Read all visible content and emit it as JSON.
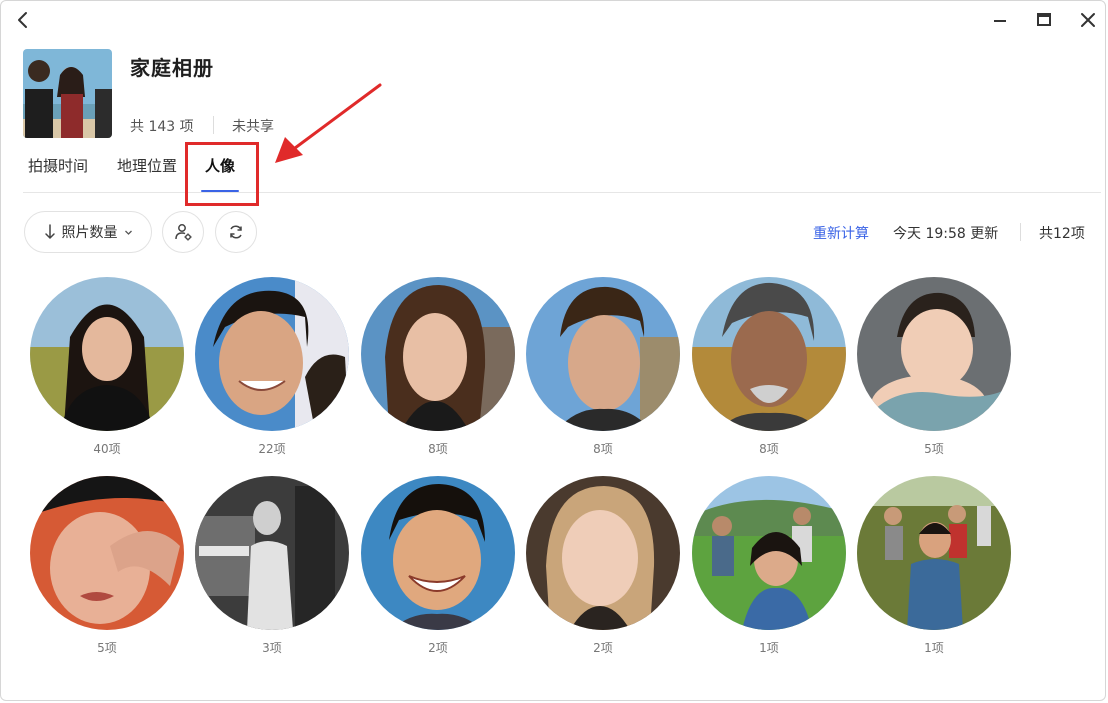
{
  "album": {
    "title": "家庭相册",
    "count": "共 143 项",
    "share_status": "未共享"
  },
  "tabs": [
    {
      "label": "拍摄时间",
      "active": false
    },
    {
      "label": "地理位置",
      "active": false
    },
    {
      "label": "人像",
      "active": true
    }
  ],
  "toolbar": {
    "sort_label": "照片数量",
    "recalculate": "重新计算",
    "updated": "今天 19:58 更新",
    "total": "共12项"
  },
  "people": [
    {
      "count": "40项"
    },
    {
      "count": "22项"
    },
    {
      "count": "8项"
    },
    {
      "count": "8项"
    },
    {
      "count": "8项"
    },
    {
      "count": "5项"
    },
    {
      "count": "5项"
    },
    {
      "count": "3项"
    },
    {
      "count": "2项"
    },
    {
      "count": "2项"
    },
    {
      "count": "1项"
    },
    {
      "count": "1项"
    }
  ],
  "colors": {
    "accent": "#3a63e6",
    "annotation": "#e02a2a"
  }
}
